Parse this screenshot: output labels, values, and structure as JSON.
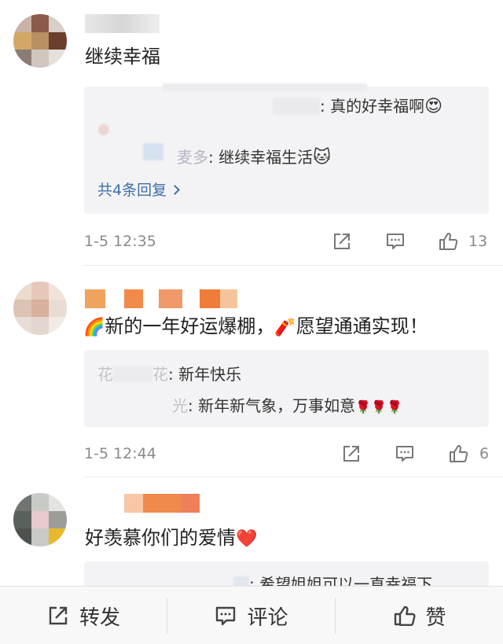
{
  "comments": [
    {
      "text": "继续幸福",
      "replies": [
        {
          "author": "",
          "text": ": 真的好幸福啊",
          "emoji": "😍"
        },
        {
          "author": "麦多",
          "text": ": 继续幸福生活",
          "emoji": "🐱"
        }
      ],
      "more_replies": "共4条回复",
      "time": "1-5 12:35",
      "likes": "13"
    },
    {
      "text": "新的一年好运爆棚，",
      "text_emoji_1": "🌈",
      "text_emoji_2": "🧨",
      "text_tail": "愿望通通实现！",
      "replies": [
        {
          "author": "花",
          "author_tail": "花",
          "text": ": 新年快乐"
        },
        {
          "author": "光",
          "text": ": 新年新气象，万事如意",
          "emoji": "🌹🌹🌹"
        }
      ],
      "time": "1-5 12:44",
      "likes": "6"
    },
    {
      "text": "好羡慕你们的爱情",
      "emoji": "❤️",
      "replies": [
        {
          "author": "",
          "text": ": 希望姐姐可以一直幸福下"
        }
      ]
    }
  ],
  "bottom_bar": {
    "repost_label": "转发",
    "comment_label": "评论",
    "like_label": "赞"
  },
  "icons": {
    "share": "share-icon",
    "comment": "comment-icon",
    "like": "thumbs-up-icon"
  },
  "colors": {
    "link": "#3f6ea8",
    "meta": "#8a8a8a",
    "reply_bg": "#f3f3f5"
  }
}
